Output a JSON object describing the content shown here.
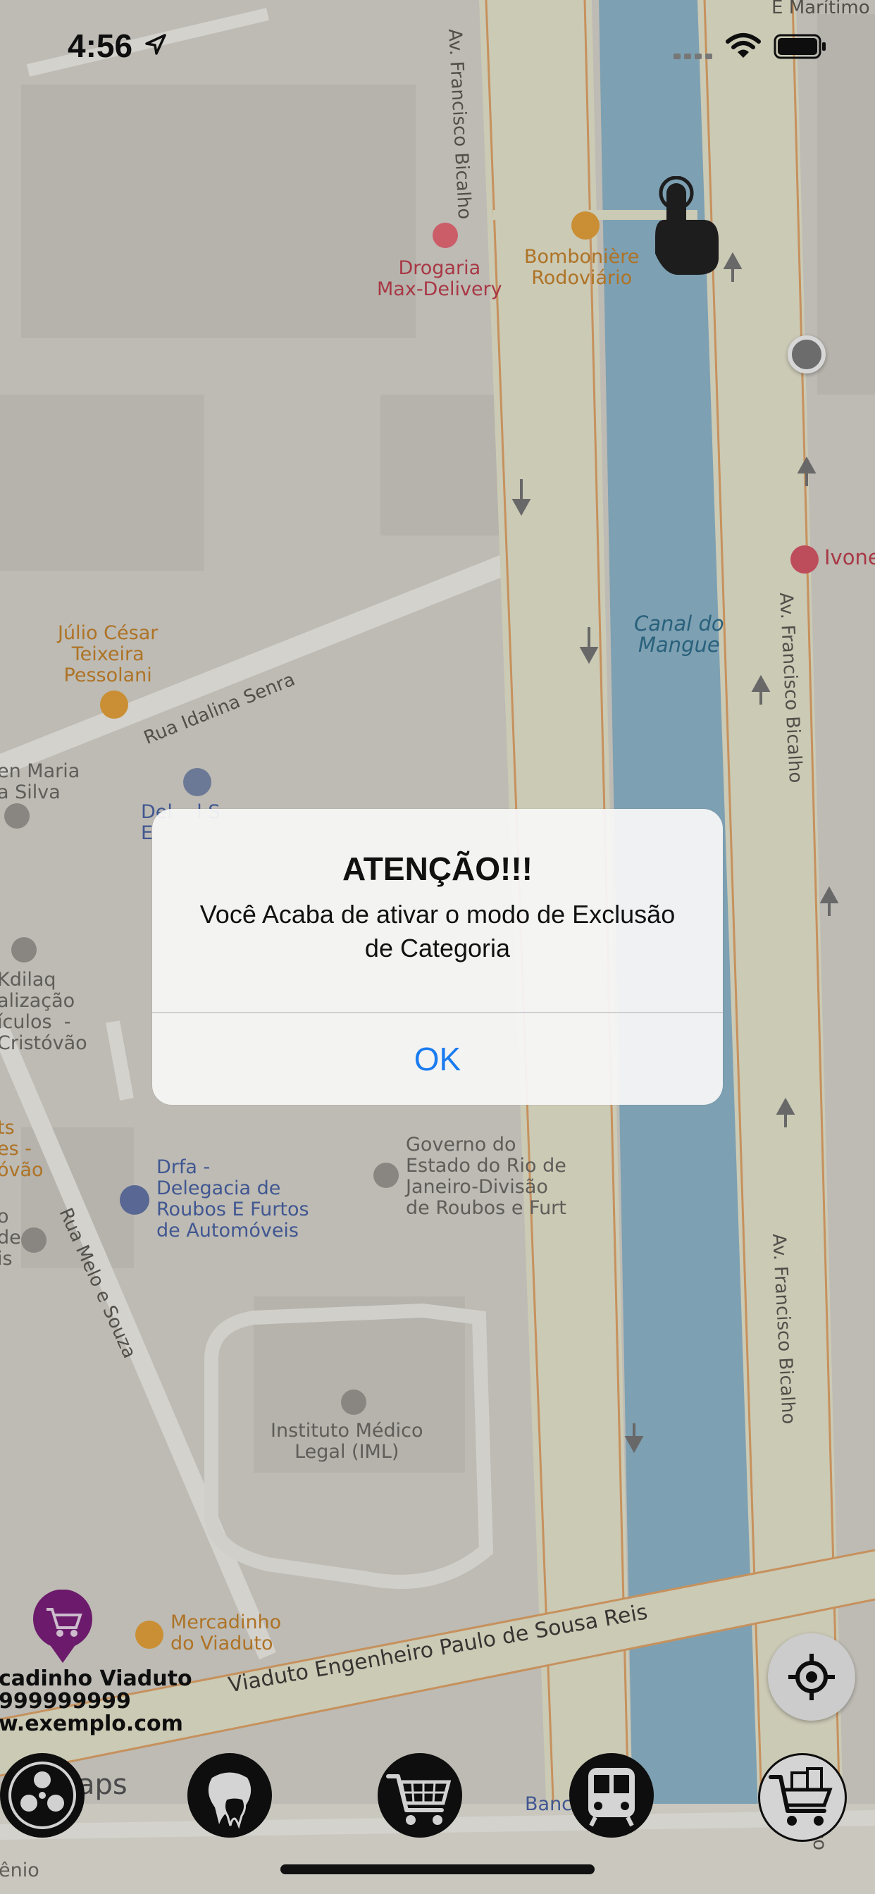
{
  "status_bar": {
    "time": "4:56"
  },
  "map": {
    "streets": {
      "av_bicalho_top": "Av. Francisco Bicalho",
      "av_bicalho_right1": "Av. Francisco Bicalho",
      "av_bicalho_right2": "Av. Francisco Bicalho",
      "rua_idalina": "Rua Idalina Senra",
      "rua_melo": "Rua Melo e Souza",
      "viaduto": "Viaduto Engenheiro Paulo de Sousa Reis",
      "top_right": "E Marítimo",
      "bottom_right": "cisco",
      "bottom_center": "Banc       sco"
    },
    "water": {
      "canal": "Canal do\nMangue"
    },
    "pois": {
      "drogaria": "Drogaria\nMax-Delivery",
      "bomboniere": "Bombonière\nRodoviário",
      "ivone": "Ivone",
      "julio": "Júlio César\nTeixeira\nPessolani",
      "maria": "en Maria\na Silva",
      "delegacia_small": "Del    l S\nE",
      "kdilaq": "Kdilaq\nalização\nículos  -\nCristóvão",
      "ts": "ts\nes -\nóvão",
      "o_de": "o\nde\nis",
      "drfa": "Drfa -\nDelegacia de\nRoubos E Furtos\nde Automóveis",
      "governo": "Governo do\nEstado do Rio de\nJaneiro-Divisão\nde Roubos e Furt",
      "iml": "Instituto Médico\nLegal (IML)",
      "mercadinho": "Mercadinho\ndo Viaduto",
      "maps_legal": "aps",
      "enio": "ênio"
    },
    "custom_pin": {
      "name": "cadinho Viaduto",
      "phone": "999999999",
      "site": "w.exemplo.com"
    }
  },
  "alert": {
    "title": "ATENÇÃO!!!",
    "message": "Você Acaba de ativar o modo de Exclusão de Categoria",
    "ok_label": "OK"
  },
  "toolbar": {
    "items": [
      {
        "icon": "reel-icon"
      },
      {
        "icon": "tooth-icon"
      },
      {
        "icon": "cart-icon"
      },
      {
        "icon": "bus-icon"
      },
      {
        "icon": "basket-icon"
      }
    ]
  },
  "colors": {
    "accent": "#1a7cf0",
    "water": "#8fb7cb",
    "road": "#e6e2c9",
    "pin": "#7b1e7a"
  }
}
